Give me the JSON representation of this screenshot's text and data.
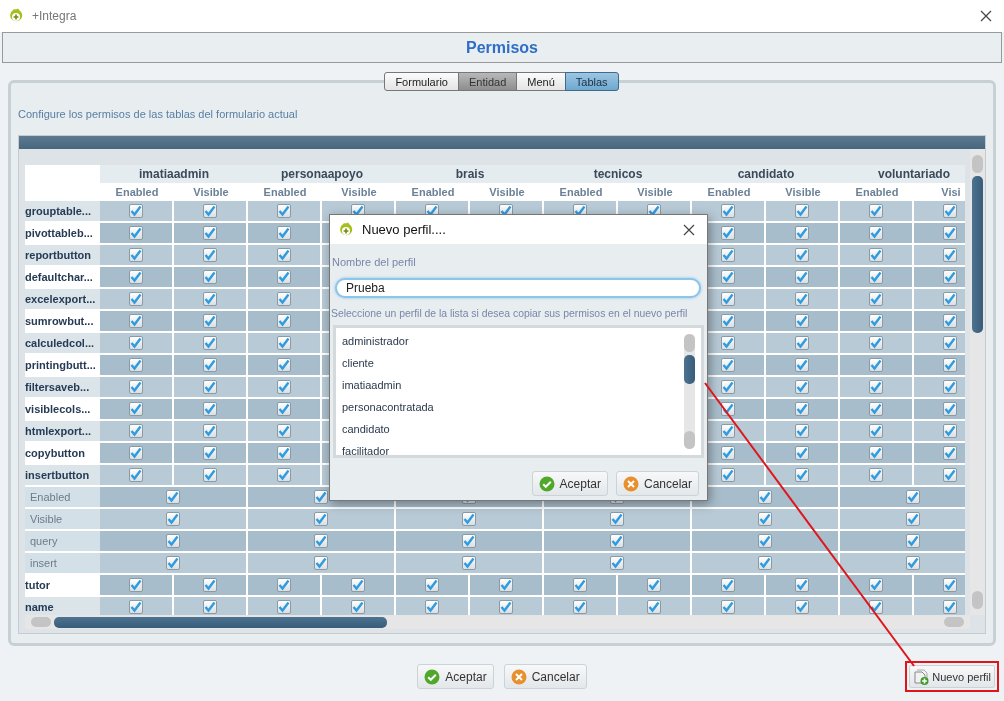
{
  "window": {
    "title": "+Integra"
  },
  "header": {
    "title": "Permisos"
  },
  "tabs": [
    {
      "label": "Formulario",
      "selected": false,
      "disabled": false
    },
    {
      "label": "Entidad",
      "selected": false,
      "disabled": true
    },
    {
      "label": "Menú",
      "selected": false,
      "disabled": false
    },
    {
      "label": "Tablas",
      "selected": true,
      "disabled": false
    }
  ],
  "description": "Configure los permisos de las tablas del formulario actual",
  "table": {
    "profiles": [
      {
        "name": "imatiaadmin",
        "columns": [
          "Enabled",
          "Visible"
        ]
      },
      {
        "name": "personaapoyo",
        "columns": [
          "Enabled",
          "Visible"
        ]
      },
      {
        "name": "brais",
        "columns": [
          "Enabled",
          "Visible"
        ]
      },
      {
        "name": "tecnicos",
        "columns": [
          "Enabled",
          "Visible"
        ]
      },
      {
        "name": "candidato",
        "columns": [
          "Enabled",
          "Visible"
        ]
      },
      {
        "name": "voluntariado",
        "columns": [
          "Enabled",
          "Visi"
        ]
      }
    ],
    "rows": [
      {
        "kind": "button",
        "label": "grouptable...",
        "checked": [
          true,
          true,
          true,
          true,
          true,
          true,
          true,
          true,
          true,
          true,
          true,
          true
        ]
      },
      {
        "kind": "covered",
        "label": "pivottableb...",
        "checked_left": [
          true,
          true,
          true
        ],
        "checked_right": [
          true,
          true,
          true,
          true
        ]
      },
      {
        "kind": "covered",
        "label": "reportbutton",
        "checked_left": [
          true,
          true,
          true
        ],
        "checked_right": [
          true,
          true,
          true,
          true
        ]
      },
      {
        "kind": "covered",
        "label": "defaultchar...",
        "checked_left": [
          true,
          true,
          true
        ],
        "checked_right": [
          true,
          true,
          true,
          true
        ]
      },
      {
        "kind": "covered",
        "label": "excelexport...",
        "checked_left": [
          true,
          true,
          true
        ],
        "checked_right": [
          true,
          true,
          true,
          true
        ]
      },
      {
        "kind": "covered",
        "label": "sumrowbut...",
        "checked_left": [
          true,
          true,
          true
        ],
        "checked_right": [
          true,
          true,
          true,
          true
        ]
      },
      {
        "kind": "covered",
        "label": "calculedcol...",
        "checked_left": [
          true,
          true,
          true
        ],
        "checked_right": [
          true,
          true,
          true,
          true
        ]
      },
      {
        "kind": "covered",
        "label": "printingbutt...",
        "checked_left": [
          true,
          true,
          true
        ],
        "checked_right": [
          true,
          true,
          true,
          true
        ]
      },
      {
        "kind": "covered",
        "label": "filtersaveb...",
        "checked_left": [
          true,
          true,
          true
        ],
        "checked_right": [
          true,
          true,
          true,
          true
        ]
      },
      {
        "kind": "covered",
        "label": "visiblecols...",
        "checked_left": [
          true,
          true,
          true
        ],
        "checked_right": [
          true,
          true,
          true,
          true
        ]
      },
      {
        "kind": "covered",
        "label": "htmlexport...",
        "checked_left": [
          true,
          true,
          true
        ],
        "checked_right": [
          true,
          true,
          true,
          true
        ]
      },
      {
        "kind": "covered",
        "label": "copybutton",
        "checked_left": [
          true,
          true,
          true
        ],
        "checked_right": [
          true,
          true,
          true,
          true
        ]
      },
      {
        "kind": "covered",
        "label": "insertbutton",
        "checked_left": [
          true,
          true,
          true
        ],
        "checked_right": [
          true,
          true,
          true,
          true
        ]
      },
      {
        "kind": "property",
        "label": "Enabled",
        "checked": [
          true,
          true,
          true,
          true,
          true,
          true
        ]
      },
      {
        "kind": "property",
        "label": "Visible",
        "checked": [
          true,
          true,
          true,
          true,
          true,
          true
        ]
      },
      {
        "kind": "property",
        "label": "query",
        "checked": [
          true,
          true,
          true,
          true,
          true,
          true
        ]
      },
      {
        "kind": "property",
        "label": "insert",
        "checked": [
          true,
          true,
          true,
          true,
          true,
          true
        ]
      },
      {
        "kind": "button",
        "label": "tutor",
        "checked": [
          true,
          true,
          true,
          true,
          true,
          true,
          true,
          true,
          true,
          true,
          true,
          true
        ]
      },
      {
        "kind": "button",
        "label": "name",
        "checked": [
          true,
          true,
          true,
          true,
          true,
          true,
          true,
          true,
          true,
          true,
          true,
          true
        ]
      }
    ]
  },
  "dialog": {
    "title": "Nuevo perfil....",
    "name_label": "Nombre del perfil",
    "name_value": "Prueba",
    "hint": "Seleccione un perfil de la lista si desea copiar sus permisos en el nuevo perfil",
    "profiles": [
      {
        "label": "administrador",
        "selected": false
      },
      {
        "label": "cliente",
        "selected": false
      },
      {
        "label": "imatiaadmin",
        "selected": false
      },
      {
        "label": "personacontratada",
        "selected": false
      },
      {
        "label": "candidato",
        "selected": false
      },
      {
        "label": "facilitador",
        "selected": false
      }
    ],
    "buttons": [
      {
        "label": "Aceptar",
        "kind": "accept"
      },
      {
        "label": "Cancelar",
        "kind": "cancel"
      }
    ]
  },
  "buttons": [
    {
      "label": "Aceptar",
      "kind": "accept"
    },
    {
      "label": "Cancelar",
      "kind": "cancel"
    }
  ],
  "new_profile_button": {
    "label": "Nuevo perfil",
    "highlighted": true
  }
}
